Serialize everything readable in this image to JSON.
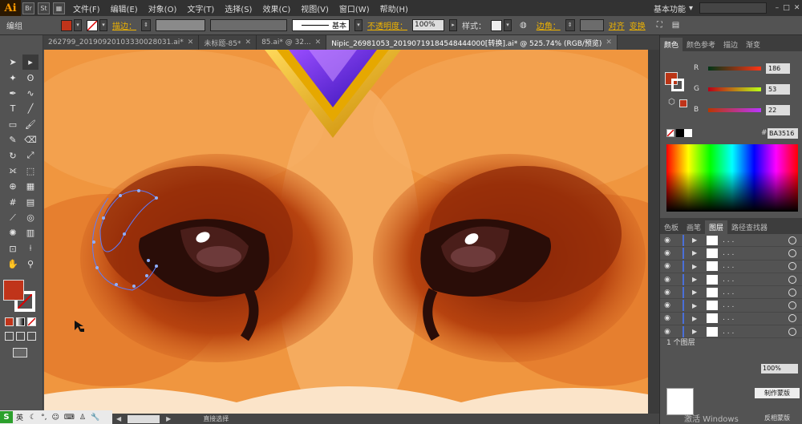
{
  "app": {
    "logo": "Ai",
    "workspace": "基本功能"
  },
  "menu": [
    "文件(F)",
    "编辑(E)",
    "对象(O)",
    "文字(T)",
    "选择(S)",
    "效果(C)",
    "视图(V)",
    "窗口(W)",
    "帮助(H)"
  ],
  "control": {
    "mode": "编组",
    "stroke_label": "描边：",
    "brush_label": "基本",
    "opacity_label": "不透明度：",
    "opacity_value": "100%",
    "style_label": "样式：",
    "corner_label": "边角：",
    "align_label": "对齐",
    "transform_label": "变换"
  },
  "tabs": [
    {
      "label": "262799_20190920103330028031.ai*",
      "active": false
    },
    {
      "label": "未标题-85*",
      "active": false
    },
    {
      "label": "85.ai* @ 32...",
      "active": false
    },
    {
      "label": "Nipic_26981053_20190719184548444000[转换].ai* @ 525.74% (RGB/预览)",
      "active": true
    }
  ],
  "color_panel": {
    "tabs": [
      "颜色",
      "颜色参考",
      "描边",
      "渐变"
    ],
    "r_label": "R",
    "r_value": "186",
    "g_label": "G",
    "g_value": "53",
    "b_label": "B",
    "b_value": "22",
    "hex_prefix": "#",
    "hex_value": "BA3516",
    "current_color": "#ba3516"
  },
  "layers_panel": {
    "tabs": [
      "色板",
      "画笔",
      "图层",
      "路径查找器"
    ],
    "rows": 8,
    "footer": "1 个图层"
  },
  "status": {
    "tool": "直接选择"
  },
  "taskbar": {
    "ime": "英"
  },
  "watermark": {
    "line1": "激活 Windows",
    "line2": "反相蒙版",
    "button": "制作蒙版"
  },
  "zoom_small": "100%",
  "colors": {
    "fill": "#c0341a",
    "accent": "#f0b400",
    "layer_bar": "#4a6fd8"
  }
}
